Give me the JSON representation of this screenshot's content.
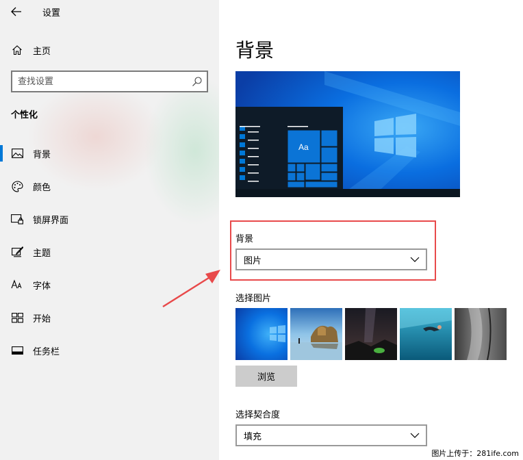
{
  "window": {
    "title": "设置"
  },
  "sidebar": {
    "home_label": "主页",
    "search_placeholder": "查找设置",
    "section_title": "个性化",
    "items": [
      {
        "label": "背景",
        "icon": "picture-icon",
        "active": true
      },
      {
        "label": "颜色",
        "icon": "palette-icon",
        "active": false
      },
      {
        "label": "锁屏界面",
        "icon": "lock-screen-icon",
        "active": false
      },
      {
        "label": "主题",
        "icon": "brush-icon",
        "active": false
      },
      {
        "label": "字体",
        "icon": "font-icon",
        "active": false
      },
      {
        "label": "开始",
        "icon": "start-icon",
        "active": false
      },
      {
        "label": "任务栏",
        "icon": "taskbar-icon",
        "active": false
      }
    ]
  },
  "main": {
    "page_title": "背景",
    "preview_sample_text": "Aa",
    "background": {
      "label": "背景",
      "selected": "图片"
    },
    "choose_picture": {
      "label": "选择图片"
    },
    "browse_label": "浏览",
    "fit": {
      "label": "选择契合度",
      "selected": "填充"
    }
  },
  "watermark": "图片上传于：281ife.com",
  "colors": {
    "accent": "#0078d7",
    "highlight": "#e8494a",
    "sidebar_bg": "#f1f1f1"
  }
}
